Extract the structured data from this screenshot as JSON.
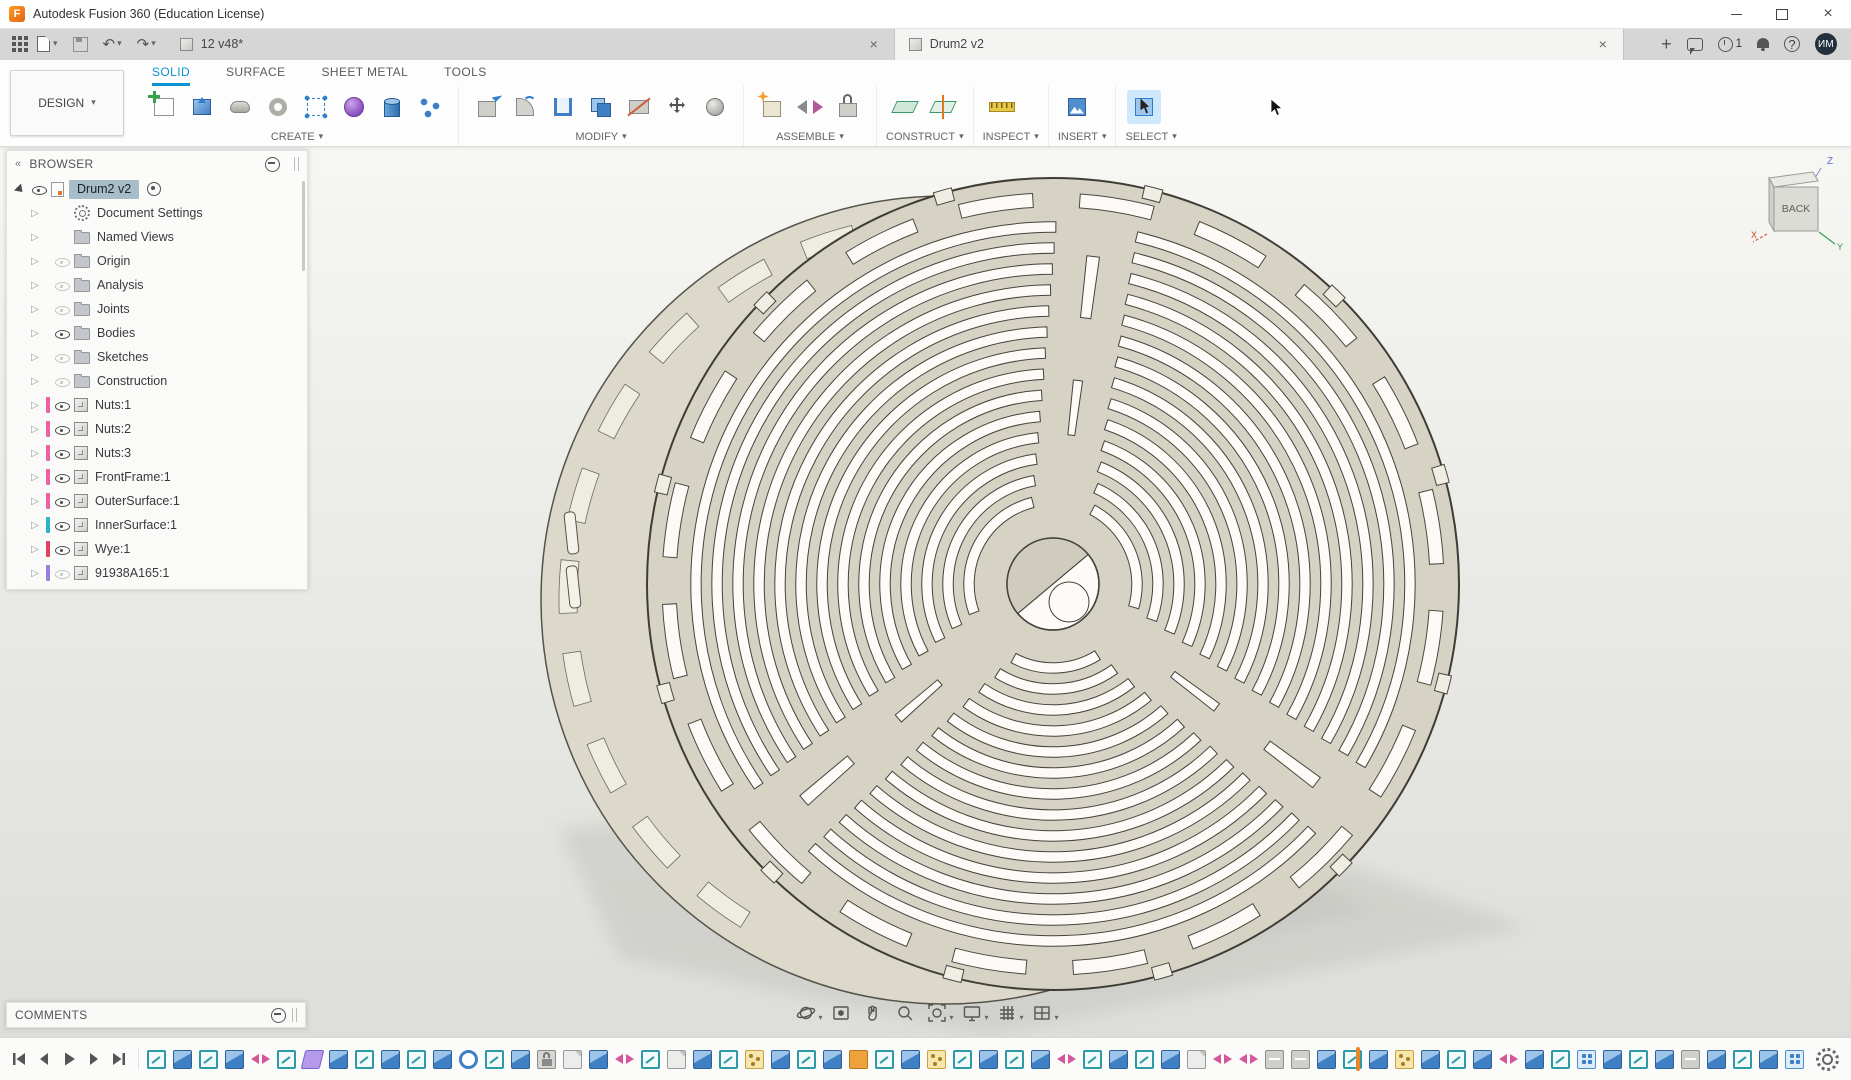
{
  "titlebar": {
    "app_title": "Autodesk Fusion 360 (Education License)"
  },
  "tabbar": {
    "tabs": [
      {
        "label": "12 v48*",
        "active": false
      },
      {
        "label": "Drum2 v2",
        "active": true
      }
    ],
    "job_badge": "1",
    "avatar_initials": "ИМ"
  },
  "ribbon": {
    "design_label": "DESIGN",
    "tabs": [
      {
        "label": "SOLID",
        "active": true
      },
      {
        "label": "SURFACE",
        "active": false
      },
      {
        "label": "SHEET METAL",
        "active": false
      },
      {
        "label": "TOOLS",
        "active": false
      }
    ],
    "groups": [
      {
        "label": "CREATE"
      },
      {
        "label": "MODIFY"
      },
      {
        "label": "ASSEMBLE"
      },
      {
        "label": "CONSTRUCT"
      },
      {
        "label": "INSPECT"
      },
      {
        "label": "INSERT"
      },
      {
        "label": "SELECT"
      }
    ]
  },
  "browser": {
    "header": "BROWSER",
    "root_label": "Drum2 v2",
    "items": [
      {
        "label": "Document Settings",
        "icon": "gear",
        "eye": "none",
        "color": ""
      },
      {
        "label": "Named Views",
        "icon": "folder",
        "eye": "none",
        "color": ""
      },
      {
        "label": "Origin",
        "icon": "folder",
        "eye": "off",
        "color": ""
      },
      {
        "label": "Analysis",
        "icon": "folder",
        "eye": "off",
        "color": ""
      },
      {
        "label": "Joints",
        "icon": "folder",
        "eye": "off",
        "color": ""
      },
      {
        "label": "Bodies",
        "icon": "folder",
        "eye": "on",
        "color": ""
      },
      {
        "label": "Sketches",
        "icon": "folder",
        "eye": "off",
        "color": ""
      },
      {
        "label": "Construction",
        "icon": "folder",
        "eye": "off",
        "color": ""
      },
      {
        "label": "Nuts:1",
        "icon": "component",
        "eye": "on",
        "color": "#ef5fa7"
      },
      {
        "label": "Nuts:2",
        "icon": "component",
        "eye": "on",
        "color": "#ef5fa7"
      },
      {
        "label": "Nuts:3",
        "icon": "component",
        "eye": "on",
        "color": "#ef5fa7"
      },
      {
        "label": "FrontFrame:1",
        "icon": "component",
        "eye": "on",
        "color": "#ef5fa7"
      },
      {
        "label": "OuterSurface:1",
        "icon": "component",
        "eye": "on",
        "color": "#ef5fa7"
      },
      {
        "label": "InnerSurface:1",
        "icon": "component",
        "eye": "on",
        "color": "#2bb3c0"
      },
      {
        "label": "Wye:1",
        "icon": "component",
        "eye": "on",
        "color": "#e0445a"
      },
      {
        "label": "91938A165:1",
        "icon": "component",
        "eye": "off",
        "color": "#9a7de0"
      }
    ]
  },
  "viewcube": {
    "face": "BACK",
    "axis_x": "X",
    "axis_y": "Y",
    "axis_z": "Z"
  },
  "comments": {
    "header": "COMMENTS"
  },
  "navbar": {
    "icons": [
      "orbit",
      "look-at",
      "pan",
      "zoom",
      "fit",
      "display-settings",
      "grid-and-snaps",
      "viewports"
    ]
  },
  "timeline": {
    "features": [
      "sketch",
      "extrude",
      "sketch",
      "extrude",
      "move",
      "sketch",
      "plane",
      "extrude",
      "sketch",
      "extrude",
      "sketch",
      "extrude",
      "revolve",
      "sketch",
      "extrude",
      "lock",
      "doc",
      "extrude",
      "move",
      "sketch",
      "doc",
      "extrude",
      "sketch",
      "point",
      "extrude",
      "sketch",
      "extrude",
      "error",
      "sketch",
      "extrude",
      "point",
      "sketch",
      "extrude",
      "sketch",
      "extrude",
      "move",
      "sketch",
      "extrude",
      "sketch",
      "extrude",
      "doc",
      "move",
      "move",
      "joint",
      "joint",
      "extrude",
      "sketch",
      "extrude",
      "point",
      "extrude",
      "sketch",
      "extrude",
      "move",
      "extrude",
      "sketch",
      "pattern",
      "extrude",
      "sketch",
      "extrude",
      "joint",
      "extrude",
      "sketch",
      "extrude",
      "pattern"
    ]
  },
  "glyphs": {
    "caret": "▾",
    "undo": "↶",
    "redo": "↷",
    "close": "×",
    "plus": "+",
    "help": "?",
    "expander": "▷",
    "collapse": "«",
    "logo_letter": "F"
  }
}
